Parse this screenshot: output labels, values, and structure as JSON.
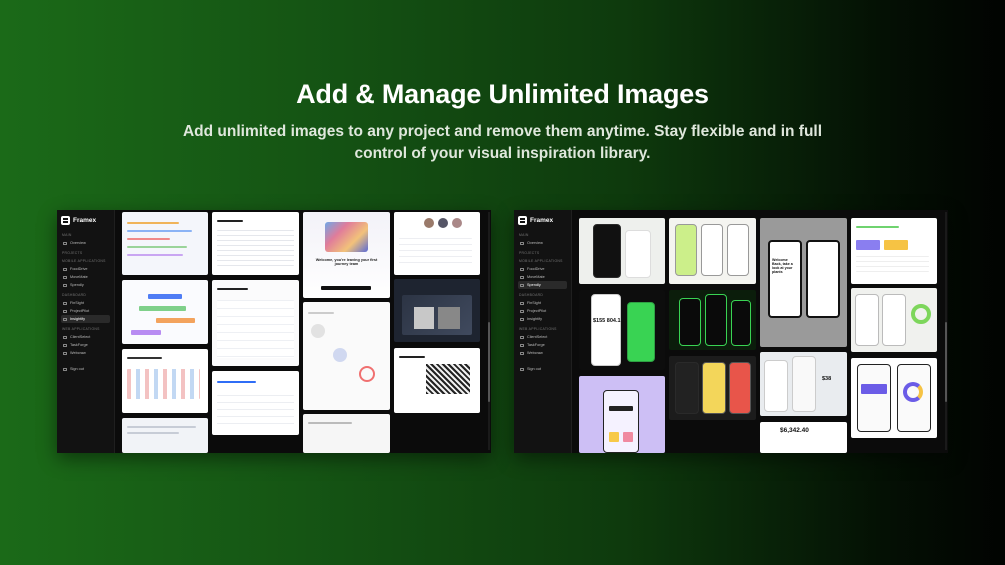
{
  "headline": "Add & Manage Unlimited Images",
  "subline": "Add unlimited images to any project and remove them anytime. Stay flexible and in full control of your visual inspiration library.",
  "app": {
    "name": "Framex",
    "main_section": "MAIN",
    "overview": "Overview",
    "projects_section": "PROJECTS",
    "mobile_section": "MOBILE APPLICATIONS",
    "mobile_items": [
      "FoodDrive",
      "MoveMate",
      "Spendly"
    ],
    "dashboard_section": "DASHBOARD",
    "dashboard_items": [
      "FinSight",
      "ProjectPilot",
      "Insightify"
    ],
    "web_section": "WEB APPLICATIONS",
    "web_items": [
      "ClientSelect",
      "TaskForge",
      "Webcraw"
    ],
    "sign_out": "Sign out"
  },
  "left_gallery": {
    "card_texts": [
      "Welcome, you're leaving your first journey team"
    ]
  },
  "right_gallery": {
    "amounts": [
      "$155 804.1",
      "$6,342.40",
      "$38"
    ],
    "promo": "Welcome Back, take a look at your plants"
  },
  "colors": {
    "accent_green": "#39d353",
    "lavender": "#cdbff5",
    "dark_card": "#1c1c1c"
  }
}
